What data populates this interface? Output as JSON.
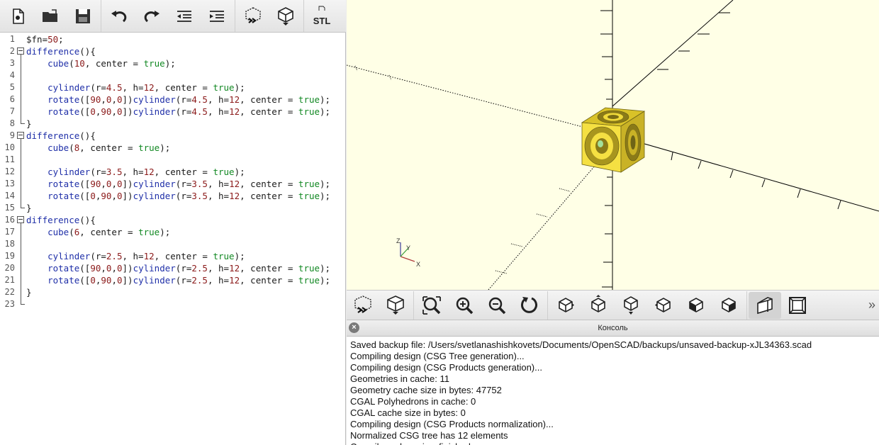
{
  "toolbar": {
    "buttons": [
      "new-file",
      "open-file",
      "save-file",
      "undo",
      "redo",
      "unindent",
      "indent",
      "preview",
      "render",
      "export-stl"
    ],
    "stl_label": "STL"
  },
  "editor": {
    "lines": [
      {
        "n": "1",
        "fold": "",
        "html": "$fn=<span class=\"num\">50</span>;"
      },
      {
        "n": "2",
        "fold": "open",
        "html": "<span class=\"kw\">difference</span>(){"
      },
      {
        "n": "3",
        "fold": "line",
        "html": "    <span class=\"fn\">cube</span>(<span class=\"num\">10</span>, center = <span class=\"bool\">true</span>);"
      },
      {
        "n": "4",
        "fold": "line",
        "html": ""
      },
      {
        "n": "5",
        "fold": "line",
        "html": "    <span class=\"fn\">cylinder</span>(r=<span class=\"num\">4.5</span>, h=<span class=\"num\">12</span>, center = <span class=\"bool\">true</span>);"
      },
      {
        "n": "6",
        "fold": "line",
        "html": "    <span class=\"fn\">rotate</span>([<span class=\"num\">90</span>,<span class=\"num\">0</span>,<span class=\"num\">0</span>])<span class=\"fn\">cylinder</span>(r=<span class=\"num\">4.5</span>, h=<span class=\"num\">12</span>, center = <span class=\"bool\">true</span>);"
      },
      {
        "n": "7",
        "fold": "line",
        "html": "    <span class=\"fn\">rotate</span>([<span class=\"num\">0</span>,<span class=\"num\">90</span>,<span class=\"num\">0</span>])<span class=\"fn\">cylinder</span>(r=<span class=\"num\">4.5</span>, h=<span class=\"num\">12</span>, center = <span class=\"bool\">true</span>);"
      },
      {
        "n": "8",
        "fold": "end",
        "html": "}"
      },
      {
        "n": "9",
        "fold": "open",
        "html": "<span class=\"kw\">difference</span>(){"
      },
      {
        "n": "10",
        "fold": "line",
        "html": "    <span class=\"fn\">cube</span>(<span class=\"num\">8</span>, center = <span class=\"bool\">true</span>);"
      },
      {
        "n": "11",
        "fold": "line",
        "html": ""
      },
      {
        "n": "12",
        "fold": "line",
        "html": "    <span class=\"fn\">cylinder</span>(r=<span class=\"num\">3.5</span>, h=<span class=\"num\">12</span>, center = <span class=\"bool\">true</span>);"
      },
      {
        "n": "13",
        "fold": "line",
        "html": "    <span class=\"fn\">rotate</span>([<span class=\"num\">90</span>,<span class=\"num\">0</span>,<span class=\"num\">0</span>])<span class=\"fn\">cylinder</span>(r=<span class=\"num\">3.5</span>, h=<span class=\"num\">12</span>, center = <span class=\"bool\">true</span>);"
      },
      {
        "n": "14",
        "fold": "line",
        "html": "    <span class=\"fn\">rotate</span>([<span class=\"num\">0</span>,<span class=\"num\">90</span>,<span class=\"num\">0</span>])<span class=\"fn\">cylinder</span>(r=<span class=\"num\">3.5</span>, h=<span class=\"num\">12</span>, center = <span class=\"bool\">true</span>);"
      },
      {
        "n": "15",
        "fold": "end",
        "html": "}"
      },
      {
        "n": "16",
        "fold": "open",
        "html": "<span class=\"kw\">difference</span>(){"
      },
      {
        "n": "17",
        "fold": "line",
        "html": "    <span class=\"fn\">cube</span>(<span class=\"num\">6</span>, center = <span class=\"bool\">true</span>);"
      },
      {
        "n": "18",
        "fold": "line",
        "html": ""
      },
      {
        "n": "19",
        "fold": "line",
        "html": "    <span class=\"fn\">cylinder</span>(r=<span class=\"num\">2.5</span>, h=<span class=\"num\">12</span>, center = <span class=\"bool\">true</span>);"
      },
      {
        "n": "20",
        "fold": "line",
        "html": "    <span class=\"fn\">rotate</span>([<span class=\"num\">90</span>,<span class=\"num\">0</span>,<span class=\"num\">0</span>])<span class=\"fn\">cylinder</span>(r=<span class=\"num\">2.5</span>, h=<span class=\"num\">12</span>, center = <span class=\"bool\">true</span>);"
      },
      {
        "n": "21",
        "fold": "line",
        "html": "    <span class=\"fn\">rotate</span>([<span class=\"num\">0</span>,<span class=\"num\">90</span>,<span class=\"num\">0</span>])<span class=\"fn\">cylinder</span>(r=<span class=\"num\">2.5</span>, h=<span class=\"num\">12</span>, center = <span class=\"bool\">true</span>);"
      },
      {
        "n": "22",
        "fold": "line",
        "html": "}"
      },
      {
        "n": "23",
        "fold": "end",
        "html": ""
      }
    ]
  },
  "viewport": {
    "axis_labels": {
      "x": "X",
      "y": "Y",
      "z": "Z"
    },
    "model_color": "#f5e042",
    "background": "#ffffe6"
  },
  "view_toolbar": {
    "buttons": [
      "preview",
      "render",
      "view-all",
      "zoom-in",
      "zoom-out",
      "reset-view",
      "view-right",
      "view-top",
      "view-bottom",
      "view-left",
      "view-front",
      "view-back",
      "perspective",
      "orthogonal"
    ],
    "more_glyph": "»"
  },
  "console": {
    "close_glyph": "×",
    "title": "Консоль",
    "lines": [
      "Saved backup file: /Users/svetlanashishkovets/Documents/OpenSCAD/backups/unsaved-backup-xJL34363.scad",
      "Compiling design (CSG Tree generation)...",
      "Compiling design (CSG Products generation)...",
      "Geometries in cache: 11",
      "Geometry cache size in bytes: 47752",
      "CGAL Polyhedrons in cache: 0",
      "CGAL cache size in bytes: 0",
      "Compiling design (CSG Products normalization)...",
      "Normalized CSG tree has 12 elements",
      "Compile and preview finished."
    ]
  }
}
